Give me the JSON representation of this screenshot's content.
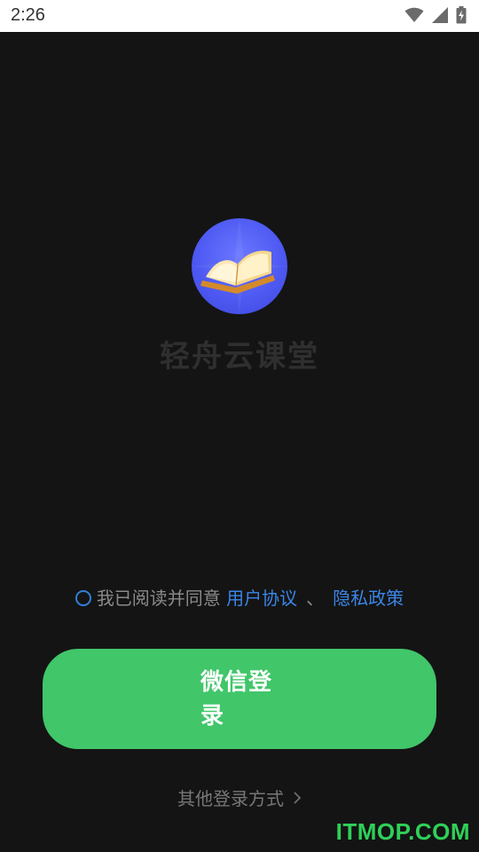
{
  "status_bar": {
    "time": "2:26",
    "icons": [
      "wifi-icon",
      "signal-icon",
      "battery-charging-icon"
    ]
  },
  "app": {
    "name": "轻舟云课堂",
    "logo_icon": "open-book-icon"
  },
  "agreement": {
    "prefix": "我已阅读并同意",
    "user_agreement": "用户协议",
    "separator": "、",
    "privacy_policy": "隐私政策"
  },
  "login": {
    "wechat_label": "微信登录",
    "other_label": "其他登录方式",
    "other_icon": "chevron-right-icon"
  },
  "watermark": "ITMOP.COM",
  "colors": {
    "background": "#141414",
    "primary_button": "#41c66a",
    "link": "#3a86e8",
    "logo_bg": "#4e5af2",
    "watermark": "#2fd058"
  }
}
